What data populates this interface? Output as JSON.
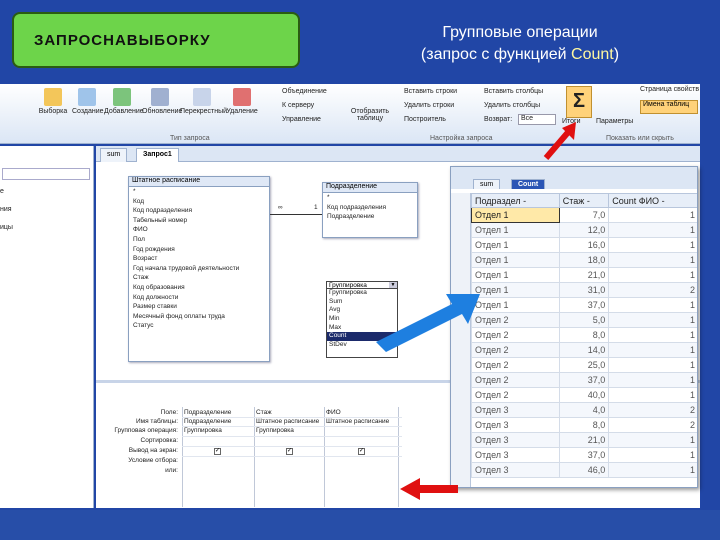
{
  "slide": {
    "label": "ЗАПРОСНАВЫБОРКУ",
    "heading_line1": "Групповые операции",
    "heading_line2_prefix": "(запрос с функцией ",
    "heading_line2_fn": "Count",
    "heading_line2_suffix": ")"
  },
  "ribbon": {
    "buttons": [
      "Выборка",
      "Создание",
      "Добавление",
      "Обновление",
      "Перекрестный",
      "Удаление"
    ],
    "small": [
      "Объединение",
      "К серверу",
      "Управление"
    ],
    "show_table": "Отобразить таблицу",
    "group_query_type": "Тип запроса",
    "group_query_setup": "Настройка запроса",
    "group_show_hide": "Показать или скрыть",
    "insert_rows": "Вставить строки",
    "delete_rows": "Удалить строки",
    "builder": "Построитель",
    "insert_cols": "Вставить столбцы",
    "delete_cols": "Удалить столбцы",
    "return": "Возврат:",
    "return_value": "Все",
    "totals": "Итоги",
    "params": "Параметры",
    "page_props": "Страница свойств",
    "table_names": "Имена таблиц"
  },
  "nav": {
    "items": [
      "е",
      "ния",
      "ицы"
    ]
  },
  "query_window": {
    "tabs": [
      "sum",
      "Запрос1"
    ],
    "table1": {
      "title": "Штатное расписание",
      "fields": [
        "*",
        "Код",
        "Код подразделения",
        "Табельный номер",
        "ФИО",
        "Пол",
        "Год рождения",
        "Возраст",
        "Год начала трудовой деятельности",
        "Стаж",
        "Код образования",
        "Код должности",
        "Размер ставки",
        "Месячный фонд оплаты труда",
        "Статус"
      ]
    },
    "table2": {
      "title": "Подразделение",
      "fields": [
        "*",
        "Код подразделения",
        "Подразделение"
      ]
    },
    "link_many": "∞",
    "link_one": "1",
    "grid": {
      "row_labels": [
        "Поле:",
        "Имя таблицы:",
        "Групповая операция:",
        "Сортировка:",
        "Вывод на экран:",
        "Условие отбора:",
        "или:"
      ],
      "columns": [
        {
          "field": "Подразделение",
          "table": "Подразделение",
          "op": "Группировка"
        },
        {
          "field": "Стаж",
          "table": "Штатное расписание",
          "op": "Группировка"
        },
        {
          "field": "ФИО",
          "table": "Штатное расписание",
          "op": "Группировка"
        }
      ],
      "check": "✓",
      "dropdown_arrow": "▼",
      "dropdown_options": [
        "Группировка",
        "Sum",
        "Avg",
        "Min",
        "Max",
        "Count",
        "StDev"
      ],
      "dropdown_selected": "Count"
    }
  },
  "result": {
    "tabs": [
      "sum",
      "Count"
    ],
    "headers": [
      "Подраздел -",
      "Стаж -",
      "Count ФИО -"
    ],
    "rows": [
      [
        "Отдел 1",
        "7,0",
        "1"
      ],
      [
        "Отдел 1",
        "12,0",
        "1"
      ],
      [
        "Отдел 1",
        "16,0",
        "1"
      ],
      [
        "Отдел 1",
        "18,0",
        "1"
      ],
      [
        "Отдел 1",
        "21,0",
        "1"
      ],
      [
        "Отдел 1",
        "31,0",
        "2"
      ],
      [
        "Отдел 1",
        "37,0",
        "1"
      ],
      [
        "Отдел 2",
        "5,0",
        "1"
      ],
      [
        "Отдел 2",
        "8,0",
        "1"
      ],
      [
        "Отдел 2",
        "14,0",
        "1"
      ],
      [
        "Отдел 2",
        "25,0",
        "1"
      ],
      [
        "Отдел 2",
        "37,0",
        "1"
      ],
      [
        "Отдел 2",
        "40,0",
        "1"
      ],
      [
        "Отдел 3",
        "4,0",
        "2"
      ],
      [
        "Отдел 3",
        "8,0",
        "2"
      ],
      [
        "Отдел 3",
        "21,0",
        "1"
      ],
      [
        "Отдел 3",
        "37,0",
        "1"
      ],
      [
        "Отдел 3",
        "46,0",
        "1"
      ]
    ]
  },
  "colors": {
    "slide_bg": "#2146a6",
    "title_box": "#6dd44a",
    "arrow_red": "#e01010",
    "arrow_blue": "#1e7fe0"
  }
}
